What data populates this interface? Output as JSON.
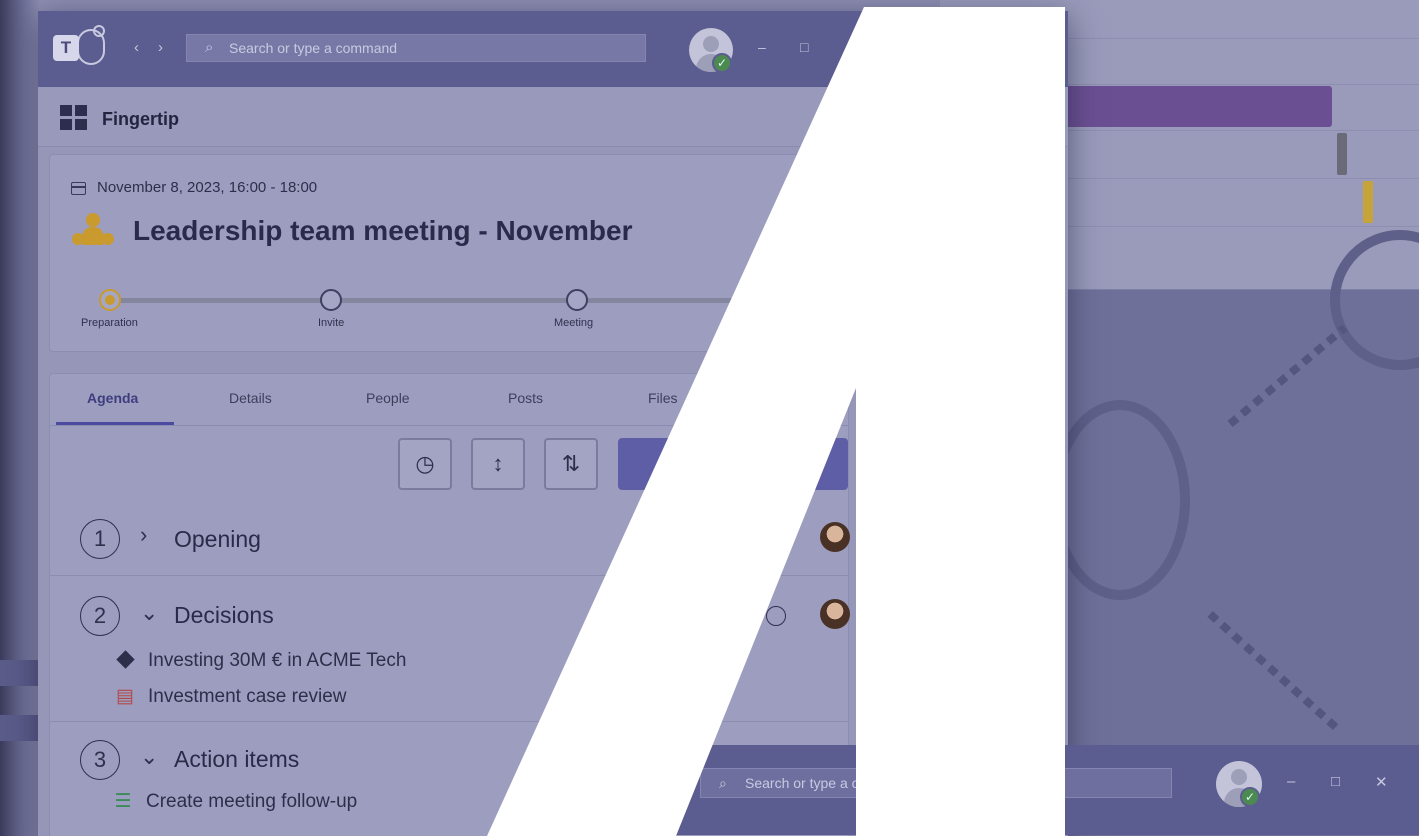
{
  "titlebar": {
    "back_icon": "chevron-left-icon",
    "forward_icon": "chevron-right-icon",
    "search_placeholder": "Search or type a command",
    "minimize": "–",
    "maximize": "□"
  },
  "app": {
    "name": "Fingertip"
  },
  "meeting": {
    "date": "November 8, 2023, 16:00 - 18:00",
    "title": "Leadership team meeting - November",
    "steps": [
      "Preparation",
      "Invite",
      "Meeting"
    ]
  },
  "tabs": [
    "Agenda",
    "Details",
    "People",
    "Posts",
    "Files"
  ],
  "toolbar": {
    "clock_icon": "clock-icon",
    "expand_icon": "expand-vertical-icon",
    "sort_icon": "sort-icon"
  },
  "agenda": [
    {
      "number": "1",
      "title": "Opening",
      "expanded": false
    },
    {
      "number": "2",
      "title": "Decisions",
      "expanded": true,
      "items": [
        "Investing 30M € in ACME Tech",
        "Investment case review"
      ]
    },
    {
      "number": "3",
      "title": "Action items",
      "expanded": true,
      "items": [
        "Create meeting follow-up"
      ]
    }
  ],
  "window2": {
    "search_placeholder": "Search or type a c",
    "minimize": "–",
    "maximize": "□",
    "close": "✕"
  },
  "colors": {
    "accent": "#5b5c8f",
    "overlay": "#9596b8",
    "step_active": "#c99a2e",
    "bar_purple": "#6b4f93",
    "bar_yellow": "#c7a43a"
  }
}
